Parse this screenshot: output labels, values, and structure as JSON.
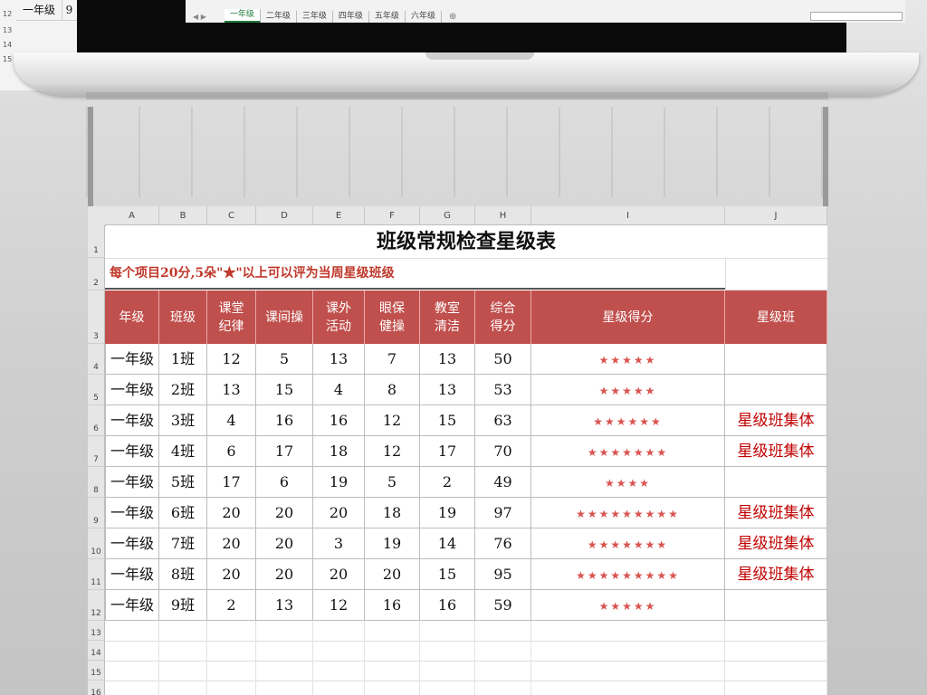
{
  "background_sheet": {
    "tab_label": "一年级",
    "cell_value": "9",
    "row_numbers": [
      "12",
      "13",
      "14",
      "15"
    ]
  },
  "laptop_screen": {
    "sheet_tabs": [
      "一年级",
      "二年级",
      "三年级",
      "四年级",
      "五年级",
      "六年级"
    ],
    "active_tab_index": 0,
    "nav_arrows": "◀  ▶",
    "add_sheet_symbol": "⊕"
  },
  "sheet": {
    "column_headers": [
      "A",
      "B",
      "C",
      "D",
      "E",
      "F",
      "G",
      "H",
      "I",
      "J"
    ],
    "row_headers": [
      "1",
      "2",
      "3",
      "4",
      "5",
      "6",
      "7",
      "8",
      "9",
      "10",
      "11",
      "12",
      "13",
      "14",
      "15",
      "16"
    ],
    "title": "班级常规检查星级表",
    "note": "每个项目20分,5朵\"★\"以上可以评为当周星级班级",
    "table_headers": {
      "grade": "年级",
      "class": "班级",
      "discipline": "课堂\n纪律",
      "exercise": "课间操",
      "activity": "课外\n活动",
      "eye": "眼保\n健操",
      "clean": "教室\n清洁",
      "total": "综合\n得分",
      "stars": "星级得分",
      "star_class": "星级班"
    },
    "rows": [
      {
        "grade": "一年级",
        "class": "1班",
        "discipline": "12",
        "exercise": "5",
        "activity": "13",
        "eye": "7",
        "clean": "13",
        "total": "50",
        "stars": "★★★★★",
        "star_class": ""
      },
      {
        "grade": "一年级",
        "class": "2班",
        "discipline": "13",
        "exercise": "15",
        "activity": "4",
        "eye": "8",
        "clean": "13",
        "total": "53",
        "stars": "★★★★★",
        "star_class": ""
      },
      {
        "grade": "一年级",
        "class": "3班",
        "discipline": "4",
        "exercise": "16",
        "activity": "16",
        "eye": "12",
        "clean": "15",
        "total": "63",
        "stars": "★★★★★★",
        "star_class": "星级班集体"
      },
      {
        "grade": "一年级",
        "class": "4班",
        "discipline": "6",
        "exercise": "17",
        "activity": "18",
        "eye": "12",
        "clean": "17",
        "total": "70",
        "stars": "★★★★★★★",
        "star_class": "星级班集体"
      },
      {
        "grade": "一年级",
        "class": "5班",
        "discipline": "17",
        "exercise": "6",
        "activity": "19",
        "eye": "5",
        "clean": "2",
        "total": "49",
        "stars": "★★★★",
        "star_class": ""
      },
      {
        "grade": "一年级",
        "class": "6班",
        "discipline": "20",
        "exercise": "20",
        "activity": "20",
        "eye": "18",
        "clean": "19",
        "total": "97",
        "stars": "★★★★★★★★★",
        "star_class": "星级班集体"
      },
      {
        "grade": "一年级",
        "class": "7班",
        "discipline": "20",
        "exercise": "20",
        "activity": "3",
        "eye": "19",
        "clean": "14",
        "total": "76",
        "stars": "★★★★★★★",
        "star_class": "星级班集体"
      },
      {
        "grade": "一年级",
        "class": "8班",
        "discipline": "20",
        "exercise": "20",
        "activity": "20",
        "eye": "20",
        "clean": "15",
        "total": "95",
        "stars": "★★★★★★★★★",
        "star_class": "星级班集体"
      },
      {
        "grade": "一年级",
        "class": "9班",
        "discipline": "2",
        "exercise": "13",
        "activity": "12",
        "eye": "16",
        "clean": "16",
        "total": "59",
        "stars": "★★★★★",
        "star_class": ""
      }
    ]
  },
  "colors": {
    "header_fill": "#c0504d",
    "note_text": "#c0392b",
    "star_color": "#d9534f",
    "star_class_text": "#c00000"
  }
}
